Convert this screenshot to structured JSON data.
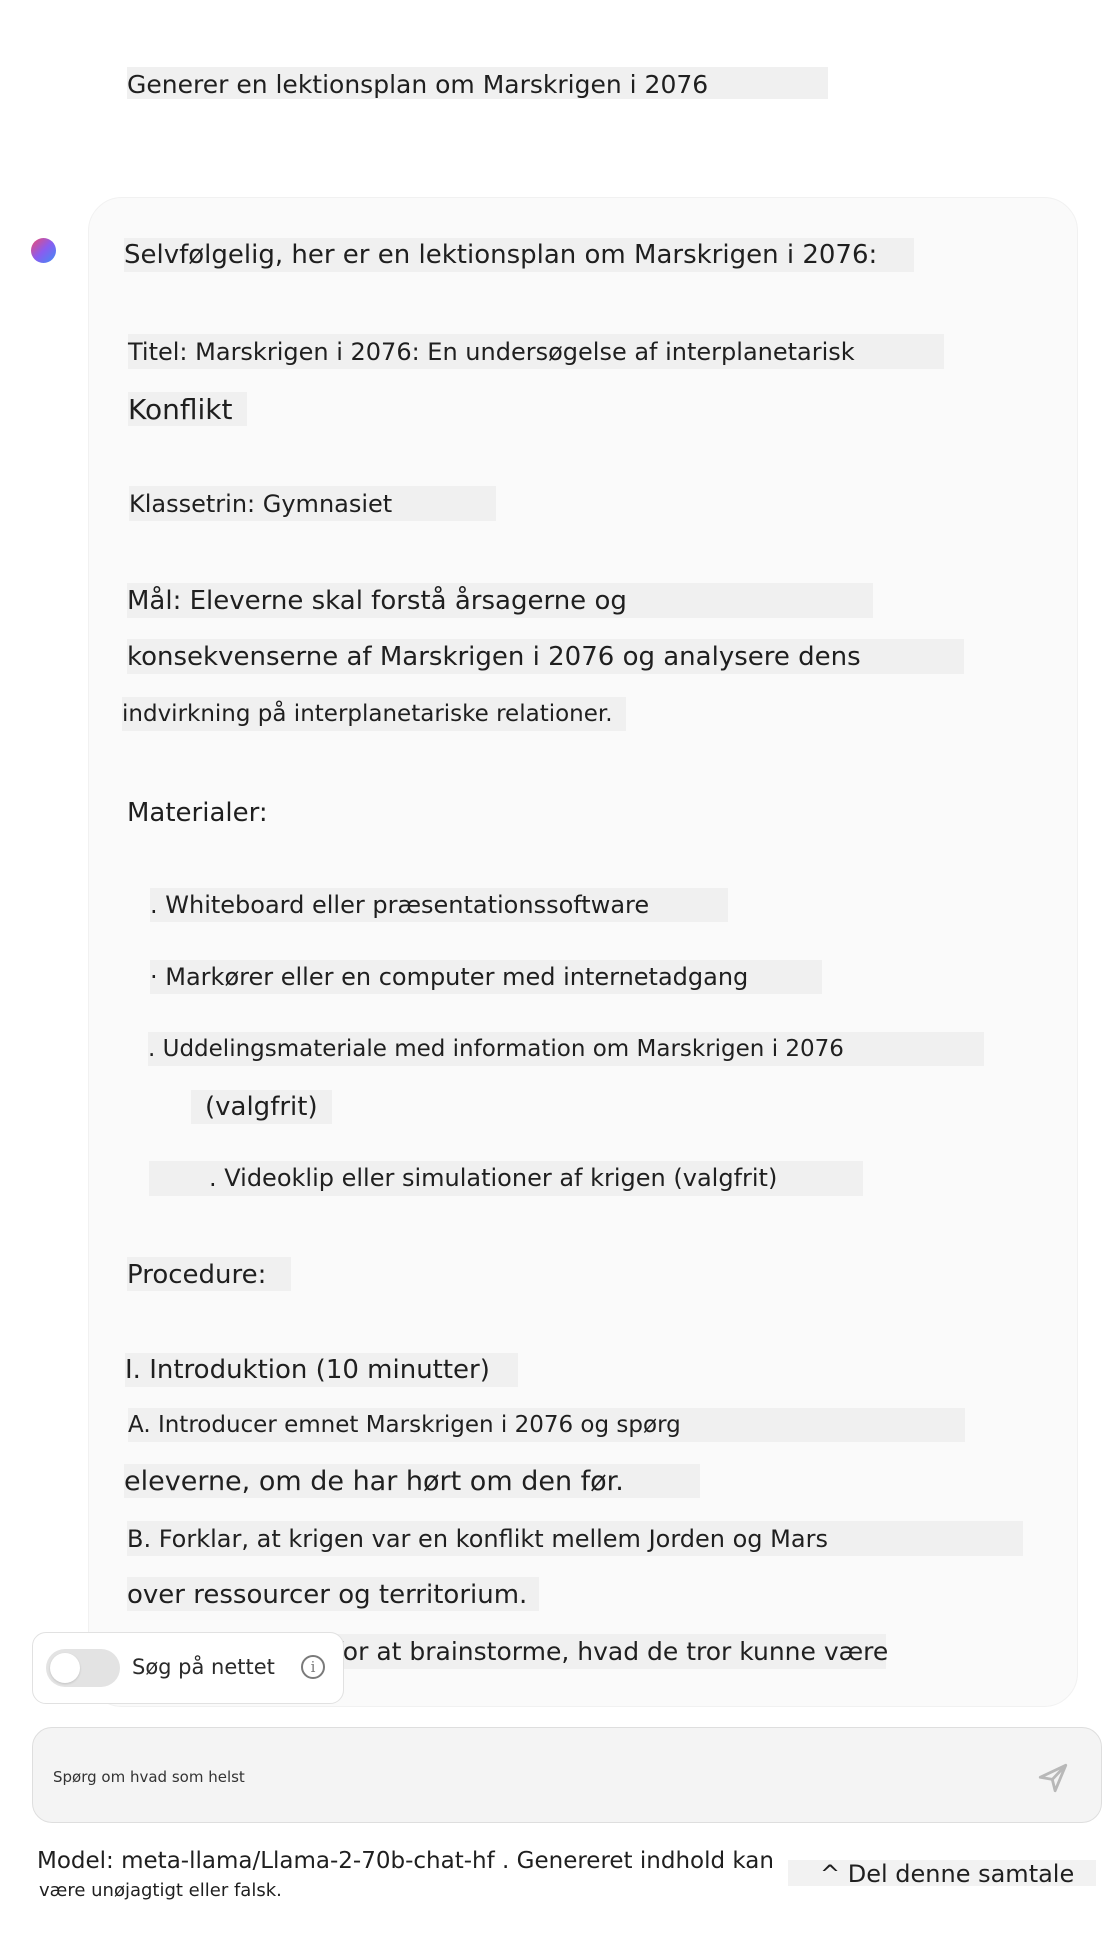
{
  "user_message": "Generer en lektionsplan om Marskrigen i 2076",
  "assistant": {
    "intro": "Selvfølgelig, her er en lektionsplan om Marskrigen i 2076:",
    "title_line1": "Titel: Marskrigen i 2076: En undersøgelse af interplanetarisk",
    "title_line2": "Konflikt",
    "grade": "Klassetrin: Gymnasiet",
    "goal_line1": "Mål: Eleverne skal forstå årsagerne og",
    "goal_line2": "konsekvenserne af Marskrigen i 2076 og analysere dens",
    "goal_line3": "indvirkning på interplanetariske relationer.",
    "materials_heading": "Materialer:",
    "materials": [
      ". Whiteboard eller præsentationssoftware",
      "· Markører eller en computer med internetadgang",
      ". Uddelingsmateriale med information om Marskrigen i 2076",
      "(valgfrit)",
      ". Videoklip eller simulationer af krigen (valgfrit)"
    ],
    "procedure_heading": "Procedure:",
    "section_1": "I. Introduktion (10 minutter)",
    "step_a_line1": "A. Introducer emnet Marskrigen i 2076 og spørg",
    "step_a_line2": "eleverne, om de har hørt om den før.",
    "step_b_line1": "B. Forklar, at krigen var en konflikt mellem Jorden og Mars",
    "step_b_line2": "over ressourcer og territorium.",
    "step_c_partial": "for at brainstorme, hvad de tror kunne være"
  },
  "web_search": {
    "label": "Søg på nettet",
    "enabled": false,
    "info_icon": "i"
  },
  "input": {
    "placeholder": "Spørg om hvad som helst"
  },
  "footer": {
    "model_line1": "Model: meta-llama/Llama-2-70b-chat-hf . Genereret indhold kan",
    "model_line2": "være unøjagtigt eller falsk.",
    "share_label": "^ Del denne samtale"
  },
  "colors": {
    "text_highlight": "#f0f0f0",
    "card_background": "#fafafa",
    "send_icon": "#b8b8b8"
  }
}
